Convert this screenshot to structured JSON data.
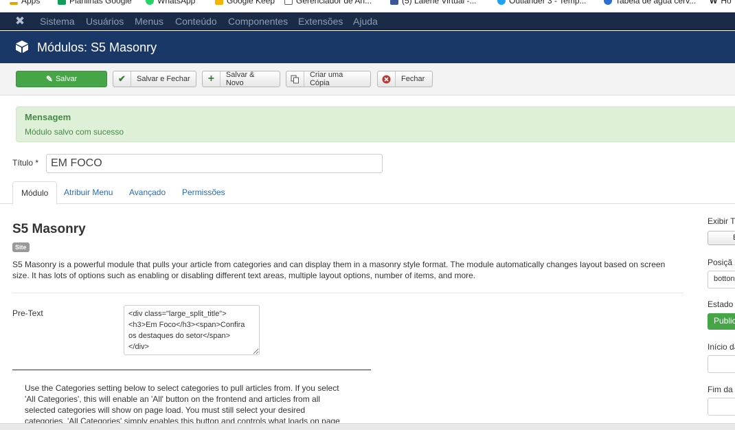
{
  "bookmarks": [
    {
      "label": "Apps",
      "color": "#e8a200"
    },
    {
      "label": "Planilhas Google",
      "color": "#0f9d58"
    },
    {
      "label": "WhatsApp",
      "color": "#25d366"
    },
    {
      "label": "Google Keep",
      "color": "#f4b400"
    },
    {
      "label": "Gerenciador de An...",
      "color": "#5f6368"
    },
    {
      "label": "(5) Lalehe Virtual -...",
      "color": "#3b5998"
    },
    {
      "label": "Outlander 3 - Temp...",
      "color": "#1da1f2"
    },
    {
      "label": "Tabela de água cerv...",
      "color": "#2c6ed5"
    },
    {
      "label": "Ho",
      "color": "#333333"
    }
  ],
  "nav": {
    "items": [
      "Sistema",
      "Usuários",
      "Menus",
      "Conteúdo",
      "Componentes",
      "Extensões",
      "Ajuda"
    ]
  },
  "header": {
    "title": "Módulos: S5 Masonry"
  },
  "toolbar": {
    "save": "Salvar",
    "save_close": "Salvar e Fechar",
    "save_new": "Salvar & Novo",
    "copy": "Criar uma Cópia",
    "close": "Fechar"
  },
  "message": {
    "title": "Mensagem",
    "text": "Módulo salvo com sucesso"
  },
  "form": {
    "title_label": "Título *",
    "title_value": "EM FOCO"
  },
  "tabs": [
    "Módulo",
    "Atribuir Menu",
    "Avançado",
    "Permissões"
  ],
  "module": {
    "name": "S5 Masonry",
    "badge": "Site",
    "description": "S5 Masonry is a powerful module that pulls your article from categories and can display them in a masonry style format. The module automatically changes layout based on screen size. It has lots of options such as enabling or disabling different text areas, multiple layout options, number of items, and more.",
    "pretext_label": "Pre-Text",
    "pretext_value": "<div class=\"large_split_title\">\n<h3>Em Foco</h3><span>Confira os destaques do setor</span>\n</div>",
    "category_help": "Use the Categories setting below to select categories to pull articles from. If you select 'All Categories', this will enable an 'All' button on the frontend and articles from all selected categories will show on page load. You must still select your desired categories, 'All Categories' simply enables this button and controls what loads on page load. If you omit 'All"
  },
  "sidebar": {
    "show_title_label": "Exibir T",
    "show_title_button": "E",
    "position_label": "Posiçã",
    "position_value": "botton",
    "status_label": "Estado",
    "status_value": "Public",
    "start_label": "Início da",
    "end_label": "Fim da"
  }
}
